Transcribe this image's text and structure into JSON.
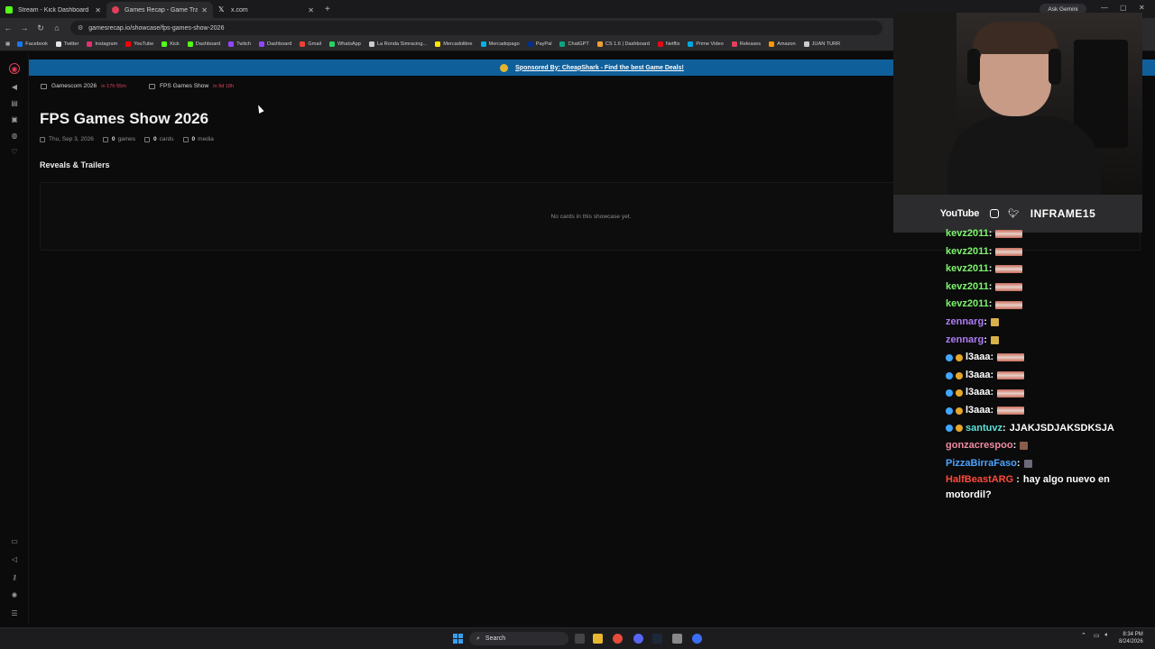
{
  "browser": {
    "tabs": [
      {
        "title": "Stream - Kick Dashboard",
        "color": "#53fc18"
      },
      {
        "title": "Games Recap - Game Trailers, A",
        "color": "#e0405a",
        "active": true
      },
      {
        "title": "x.com",
        "color": "#ffffff"
      }
    ],
    "new_tab": "+",
    "ask_gemini": "Ask Gemini",
    "url": "gamesrecap.io/showcase/fps-games-show-2026",
    "bookmarks": [
      {
        "label": "Facebook",
        "color": "#1877f2"
      },
      {
        "label": "Twitter",
        "color": "#e6e6e6"
      },
      {
        "label": "Instagram",
        "color": "#e1306c"
      },
      {
        "label": "YouTube",
        "color": "#ff0000"
      },
      {
        "label": "Kick",
        "color": "#53fc18"
      },
      {
        "label": "Dashboard",
        "color": "#53fc18"
      },
      {
        "label": "Twitch",
        "color": "#9146ff"
      },
      {
        "label": "Dashboard",
        "color": "#9146ff"
      },
      {
        "label": "Gmail",
        "color": "#ea4335"
      },
      {
        "label": "WhatsApp",
        "color": "#25d366"
      },
      {
        "label": "La Ronda Simracing...",
        "color": "#cccccc"
      },
      {
        "label": "Mercadolibre",
        "color": "#ffe600"
      },
      {
        "label": "Mercadopago",
        "color": "#00b1ea"
      },
      {
        "label": "PayPal",
        "color": "#003087"
      },
      {
        "label": "ChatGPT",
        "color": "#10a37f"
      },
      {
        "label": "CS 1.6 | Dashboard",
        "color": "#f0a030"
      },
      {
        "label": "Netflix",
        "color": "#e50914"
      },
      {
        "label": "Prime Video",
        "color": "#00a8e1"
      },
      {
        "label": "Releases",
        "color": "#e0405a"
      },
      {
        "label": "Amazon",
        "color": "#ff9900"
      },
      {
        "label": "JUAN TURR",
        "color": "#cccccc"
      }
    ]
  },
  "sponsor": {
    "text": "Sponsored By: CheapShark - Find the best Game Deals!"
  },
  "breadcrumbs": [
    {
      "label": "Gamescom 2026",
      "countdown": "in 17h 55m"
    },
    {
      "label": "FPS Games Show",
      "countdown": "in 9d 18h"
    }
  ],
  "showcase": {
    "title": "FPS Games Show 2026",
    "date": "Thu, Sep 3, 2026",
    "games_count": "0",
    "games_label": "games",
    "cards_count": "0",
    "cards_label": "cards",
    "media_count": "0",
    "media_label": "media",
    "section_title": "Reveals & Trailers",
    "empty_message": "No cards in this showcase yet."
  },
  "stream_overlay": {
    "youtube_label": "YouTube",
    "handle": "INFRAME15"
  },
  "chat": [
    {
      "user": "kevz2011",
      "color": "#7cf56b",
      "emote": "wide"
    },
    {
      "user": "kevz2011",
      "color": "#7cf56b",
      "emote": "wide"
    },
    {
      "user": "kevz2011",
      "color": "#7cf56b",
      "emote": "wide"
    },
    {
      "user": "kevz2011",
      "color": "#7cf56b",
      "emote": "wide"
    },
    {
      "user": "kevz2011",
      "color": "#7cf56b",
      "emote": "wide"
    },
    {
      "user": "zennarg",
      "color": "#b07cf5",
      "emote": "sm"
    },
    {
      "user": "zennarg",
      "color": "#b07cf5",
      "emote": "sm"
    },
    {
      "user": "l3aaa",
      "color": "#ffffff",
      "emote": "wide",
      "badges": true
    },
    {
      "user": "l3aaa",
      "color": "#ffffff",
      "emote": "wide",
      "badges": true
    },
    {
      "user": "l3aaa",
      "color": "#ffffff",
      "emote": "wide",
      "badges": true
    },
    {
      "user": "l3aaa",
      "color": "#ffffff",
      "emote": "wide",
      "badges": true
    },
    {
      "user": "santuvz",
      "color": "#5be3d8",
      "text": "JJAKJSDJAKSDKSJA",
      "badges": true
    },
    {
      "user": "gonzacrespoo",
      "color": "#f08aa0",
      "emote": "dk"
    },
    {
      "user": "PizzaBirraFaso",
      "color": "#4aa3ff",
      "emote": "gr"
    },
    {
      "user": "HalfBeastARG",
      "color": "#ff4a3a",
      "text": "hay algo nuevo en motordil?"
    }
  ],
  "taskbar": {
    "search": "Search",
    "time": "8:34 PM",
    "date": "8/24/2026"
  }
}
